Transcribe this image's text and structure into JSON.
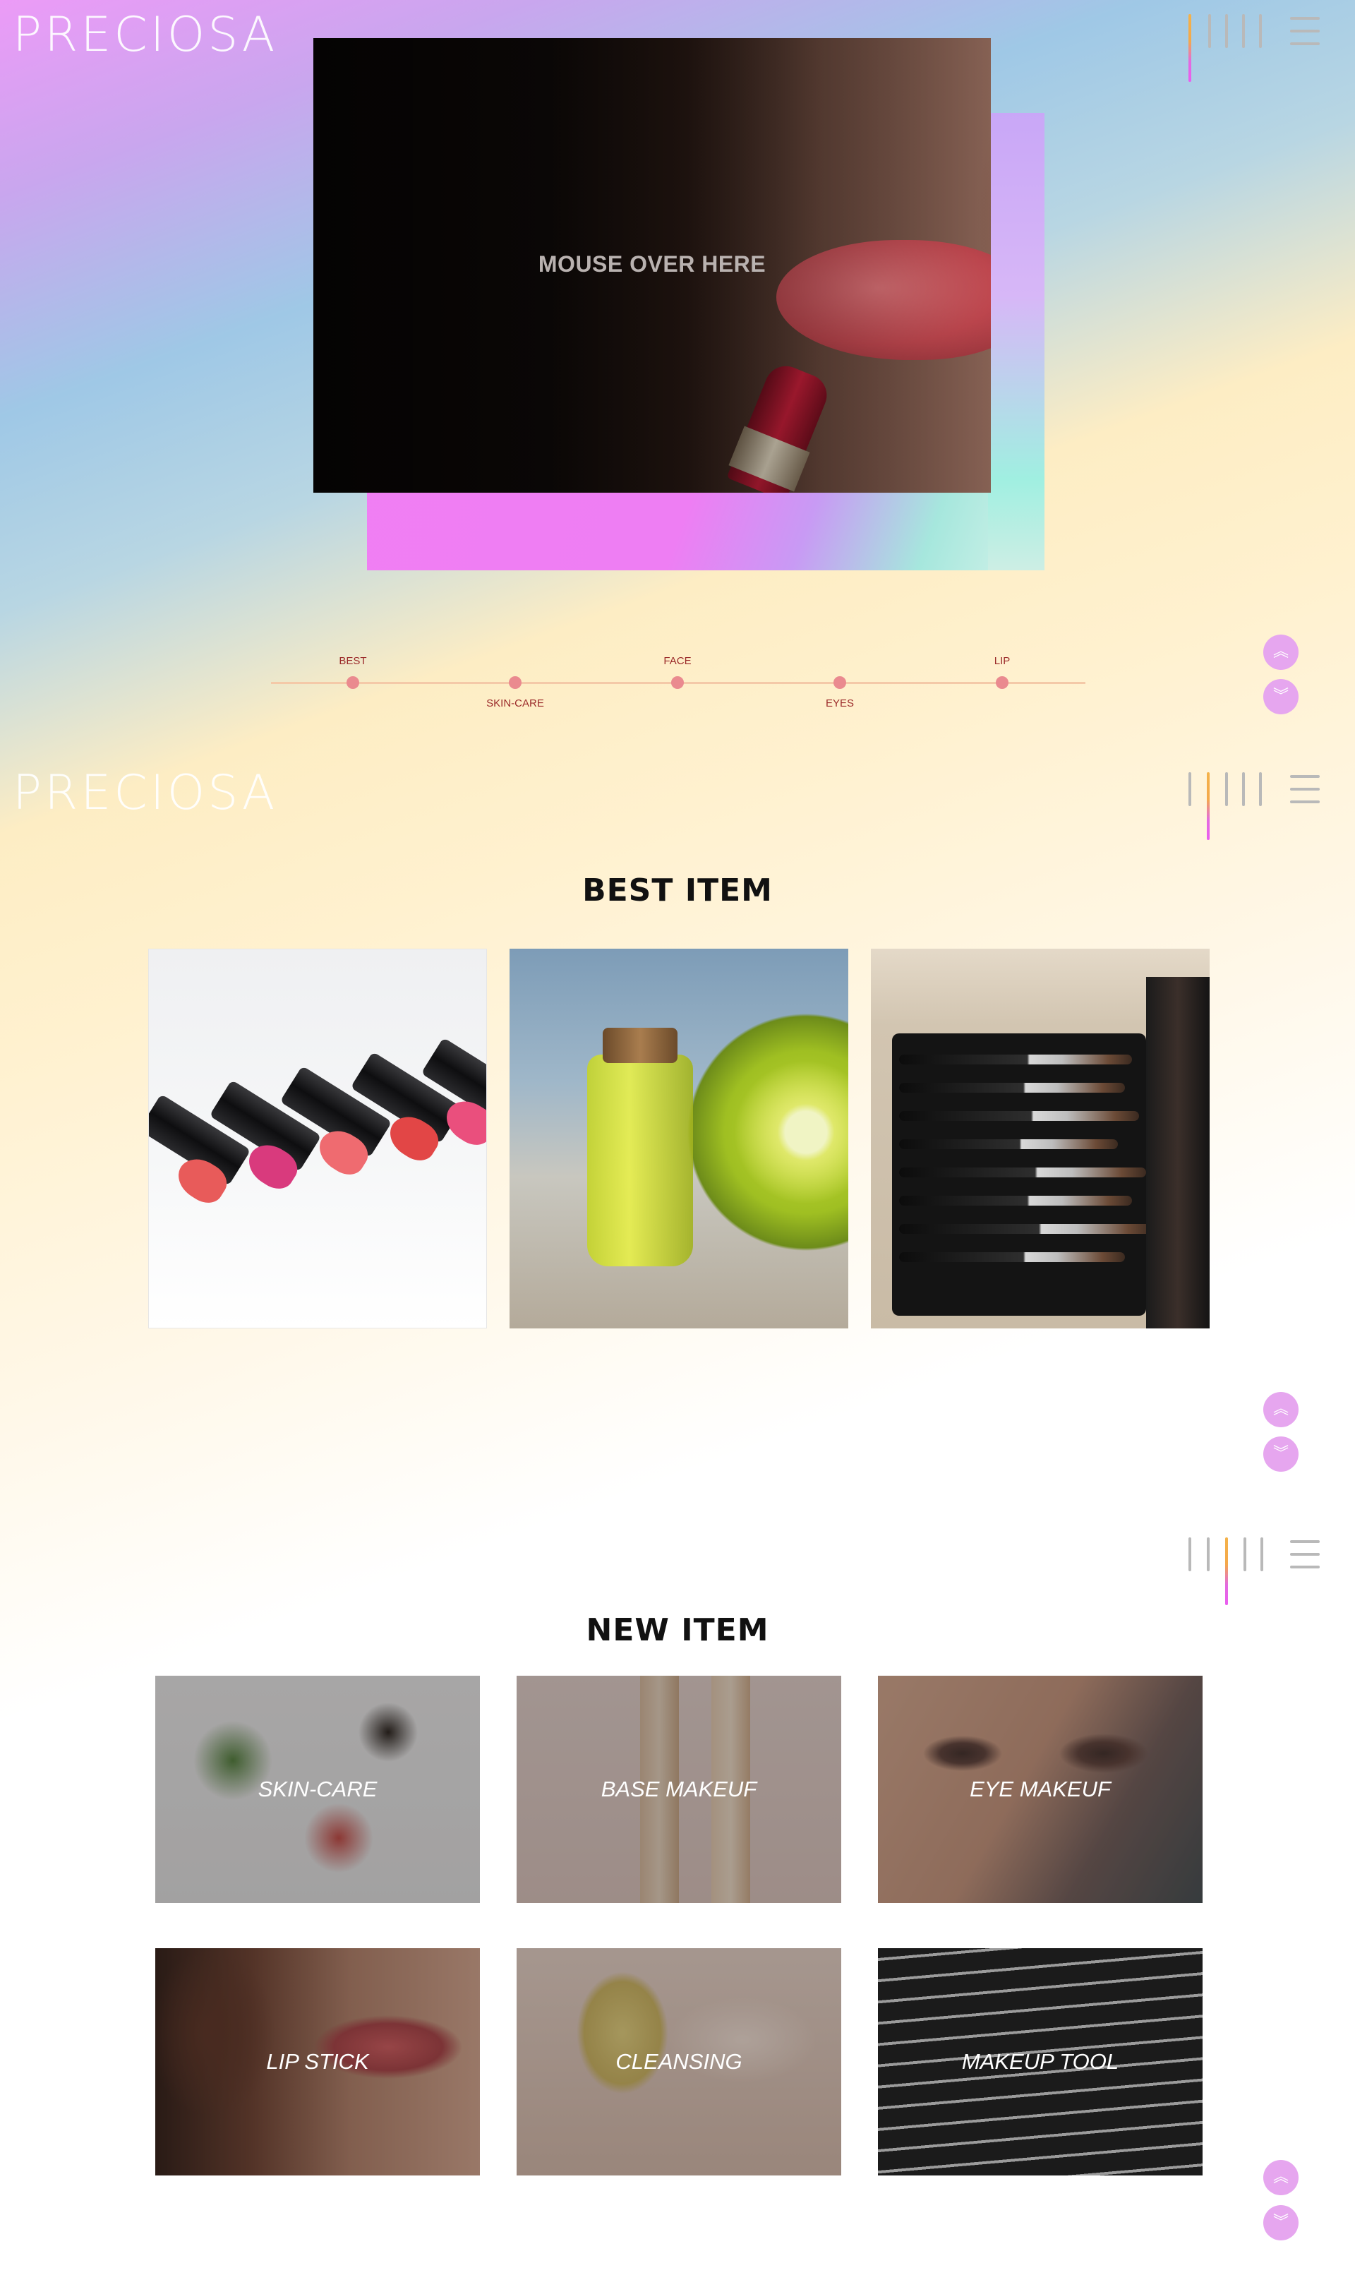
{
  "brand": {
    "logo": "PRECIOSA"
  },
  "nav": {
    "menu_icon": "hamburger-icon"
  },
  "hero": {
    "prompt": "MOUSE OVER HERE"
  },
  "timeline": {
    "items": [
      {
        "label": "BEST"
      },
      {
        "label": "SKIN-CARE"
      },
      {
        "label": "FACE"
      },
      {
        "label": "EYES"
      },
      {
        "label": "LIP"
      }
    ]
  },
  "scroll": {
    "up_icon": "chevrons-up-icon",
    "down_icon": "chevrons-down-icon",
    "up_glyph": "︽",
    "down_glyph": "︾"
  },
  "best": {
    "title": "BEST ITEM"
  },
  "new": {
    "title": "NEW ITEM",
    "items": [
      {
        "label": "SKIN-CARE"
      },
      {
        "label": "BASE MAKEUF"
      },
      {
        "label": "EYE MAKEUF"
      },
      {
        "label": "LIP STICK"
      },
      {
        "label": "CLEANSING"
      },
      {
        "label": "MAKEUP TOOL"
      }
    ]
  },
  "colors": {
    "accent_pink": "#e6a6ef",
    "timeline_dot": "#ea8a8f",
    "timeline_label": "#9b2a2a"
  }
}
